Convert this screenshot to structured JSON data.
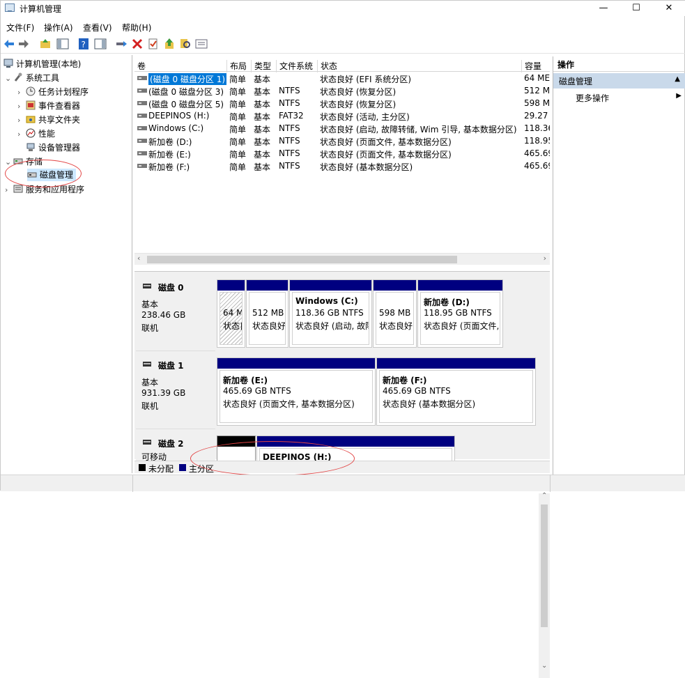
{
  "window": {
    "title": "计算机管理",
    "min": "—",
    "max": "☐",
    "close": "✕"
  },
  "menu": [
    "文件(F)",
    "操作(A)",
    "查看(V)",
    "帮助(H)"
  ],
  "tree": {
    "root": "计算机管理(本地)",
    "system_tools": "系统工具",
    "task_scheduler": "任务计划程序",
    "event_viewer": "事件查看器",
    "shared_folders": "共享文件夹",
    "performance": "性能",
    "device_manager": "设备管理器",
    "storage": "存储",
    "disk_management": "磁盘管理",
    "services_apps": "服务和应用程序"
  },
  "columns": [
    "卷",
    "布局",
    "类型",
    "文件系统",
    "状态",
    "容量"
  ],
  "volumes": [
    {
      "name": "(磁盘 0 磁盘分区 1)",
      "layout": "简单",
      "type": "基本",
      "fs": "",
      "status": "状态良好 (EFI 系统分区)",
      "cap": "64 ME"
    },
    {
      "name": "(磁盘 0 磁盘分区 3)",
      "layout": "简单",
      "type": "基本",
      "fs": "NTFS",
      "status": "状态良好 (恢复分区)",
      "cap": "512 M"
    },
    {
      "name": "(磁盘 0 磁盘分区 5)",
      "layout": "简单",
      "type": "基本",
      "fs": "NTFS",
      "status": "状态良好 (恢复分区)",
      "cap": "598 M"
    },
    {
      "name": "DEEPINOS (H:)",
      "layout": "简单",
      "type": "基本",
      "fs": "FAT32",
      "status": "状态良好 (活动, 主分区)",
      "cap": "29.27"
    },
    {
      "name": "Windows (C:)",
      "layout": "简单",
      "type": "基本",
      "fs": "NTFS",
      "status": "状态良好 (启动, 故障转储, Wim 引导, 基本数据分区)",
      "cap": "118.36"
    },
    {
      "name": "新加卷 (D:)",
      "layout": "简单",
      "type": "基本",
      "fs": "NTFS",
      "status": "状态良好 (页面文件, 基本数据分区)",
      "cap": "118.95"
    },
    {
      "name": "新加卷 (E:)",
      "layout": "简单",
      "type": "基本",
      "fs": "NTFS",
      "status": "状态良好 (页面文件, 基本数据分区)",
      "cap": "465.69"
    },
    {
      "name": "新加卷 (F:)",
      "layout": "简单",
      "type": "基本",
      "fs": "NTFS",
      "status": "状态良好 (基本数据分区)",
      "cap": "465.69"
    }
  ],
  "disks": [
    {
      "name": "磁盘 0",
      "type": "基本",
      "size": "238.46 GB",
      "state": "联机"
    },
    {
      "name": "磁盘 1",
      "type": "基本",
      "size": "931.39 GB",
      "state": "联机"
    },
    {
      "name": "磁盘 2",
      "type": "可移动",
      "size": "",
      "state": ""
    }
  ],
  "disk0_parts": [
    {
      "title": "",
      "size": "64 M",
      "status": "状态良"
    },
    {
      "title": "",
      "size": "512 MB",
      "status": "状态良好"
    },
    {
      "title": "Windows  (C:)",
      "size": "118.36 GB NTFS",
      "status": "状态良好 (启动, 故障"
    },
    {
      "title": "",
      "size": "598 MB",
      "status": "状态良好"
    },
    {
      "title": "新加卷  (D:)",
      "size": "118.95 GB NTFS",
      "status": "状态良好 (页面文件,"
    }
  ],
  "disk1_parts": [
    {
      "title": "新加卷  (E:)",
      "size": "465.69 GB NTFS",
      "status": "状态良好 (页面文件, 基本数据分区)"
    },
    {
      "title": "新加卷  (F:)",
      "size": "465.69 GB NTFS",
      "status": "状态良好 (基本数据分区)"
    }
  ],
  "disk2_part": {
    "title": "DEEPINOS  (H:)"
  },
  "legend": {
    "unalloc": "未分配",
    "primary": "主分区"
  },
  "actions": {
    "header": "操作",
    "section": "磁盘管理",
    "more": "更多操作"
  },
  "colors": {
    "primary": "#000080",
    "unallocated": "#000000",
    "selection": "#0078d7",
    "annotation": "#e24444"
  }
}
